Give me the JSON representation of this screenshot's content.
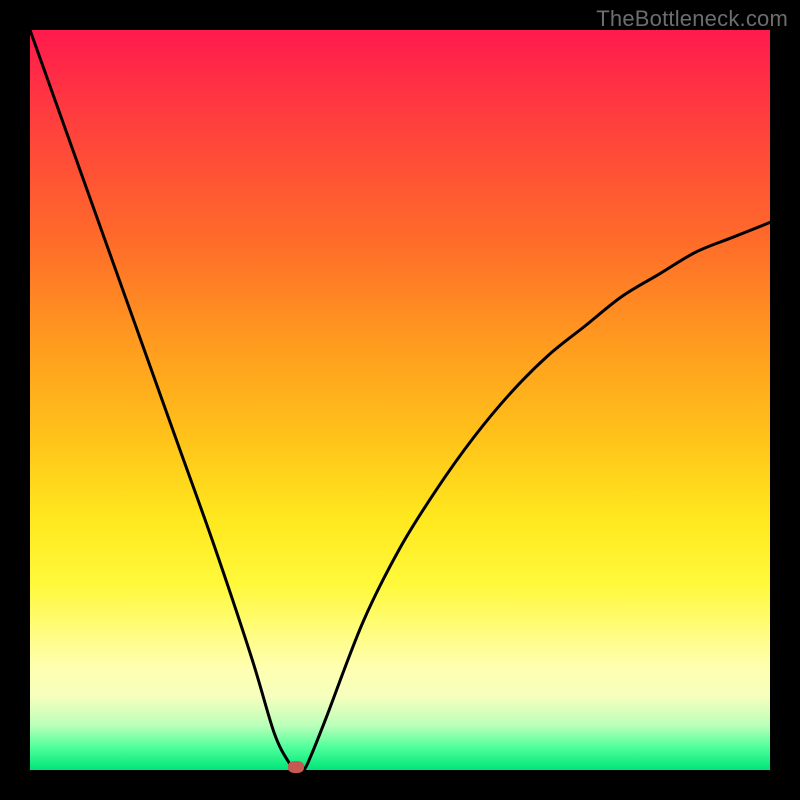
{
  "watermark": "TheBottleneck.com",
  "chart_data": {
    "type": "line",
    "title": "",
    "xlabel": "",
    "ylabel": "",
    "xlim": [
      0,
      100
    ],
    "ylim": [
      0,
      100
    ],
    "grid": false,
    "legend": false,
    "series": [
      {
        "name": "bottleneck-curve",
        "x": [
          0,
          5,
          10,
          15,
          20,
          25,
          30,
          33,
          35,
          36,
          37,
          38,
          40,
          45,
          50,
          55,
          60,
          65,
          70,
          75,
          80,
          85,
          90,
          95,
          100
        ],
        "values": [
          100,
          86,
          72,
          58,
          44,
          30,
          15,
          5,
          1,
          0,
          0,
          2,
          7,
          20,
          30,
          38,
          45,
          51,
          56,
          60,
          64,
          67,
          70,
          72,
          74
        ]
      }
    ],
    "marker": {
      "x": 36,
      "y": 0
    },
    "background_gradient": {
      "top": "#ff1a4d",
      "mid": "#ffe81e",
      "bottom": "#00e57a"
    }
  },
  "layout": {
    "image_size": 800,
    "plot_inset": 30,
    "plot_size": 740
  }
}
